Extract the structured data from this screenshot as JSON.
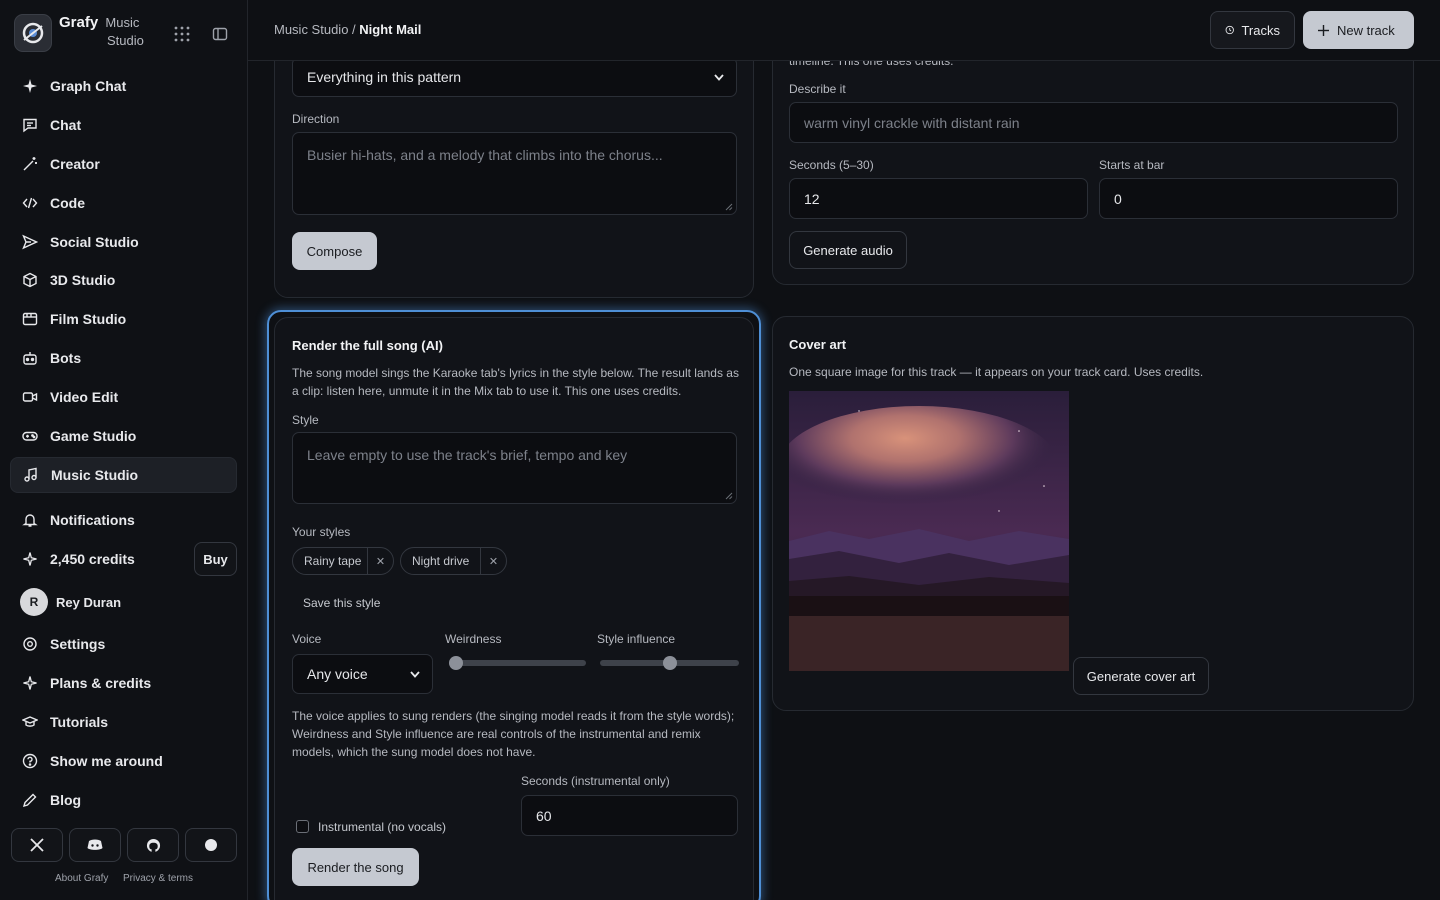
{
  "app": {
    "name": "Grafy",
    "sub_line1": "Music",
    "sub_line2": "Studio"
  },
  "sidebar": {
    "items": [
      {
        "label": "Graph Chat",
        "icon": "sparkle-icon"
      },
      {
        "label": "Chat",
        "icon": "chat-icon"
      },
      {
        "label": "Creator",
        "icon": "wand-icon"
      },
      {
        "label": "Code",
        "icon": "code-icon"
      },
      {
        "label": "Social Studio",
        "icon": "send-icon"
      },
      {
        "label": "3D Studio",
        "icon": "cube-icon"
      },
      {
        "label": "Film Studio",
        "icon": "film-icon"
      },
      {
        "label": "Bots",
        "icon": "bot-icon"
      },
      {
        "label": "Video Edit",
        "icon": "video-icon"
      },
      {
        "label": "Game Studio",
        "icon": "gamepad-icon"
      },
      {
        "label": "Music Studio",
        "icon": "music-icon"
      }
    ],
    "notifications": "Notifications",
    "credits": "2,450 credits",
    "buy": "Buy",
    "user": {
      "initial": "R",
      "name": "Rey Duran"
    },
    "settings": "Settings",
    "plans": "Plans & credits",
    "tutorials": "Tutorials",
    "tour": "Show me around",
    "blog": "Blog",
    "footer": {
      "about": "About Grafy",
      "privacy": "Privacy & terms"
    }
  },
  "topbar": {
    "crumb_parent": "Music Studio",
    "crumb_sep": " / ",
    "crumb_current": "Night Mail",
    "tracks": "Tracks",
    "new_track": "New track"
  },
  "compose": {
    "select_value": "Everything in this pattern",
    "direction_label": "Direction",
    "direction_placeholder": "Busier hi-hats, and a melody that climbs into the chorus...",
    "button": "Compose"
  },
  "sfx": {
    "cut_text": "timeline. This one uses credits.",
    "describe_label": "Describe it",
    "describe_placeholder": "warm vinyl crackle with distant rain",
    "seconds_label": "Seconds (5–30)",
    "seconds_value": "12",
    "bar_label": "Starts at bar",
    "bar_value": "0",
    "button": "Generate audio"
  },
  "render": {
    "title": "Render the full song (AI)",
    "desc_line1": "The song model sings the Karaoke tab's lyrics in the style below. The result lands as",
    "desc_line2": "a clip: listen here, unmute it in the Mix tab to use it. This one uses credits.",
    "style_label": "Style",
    "style_placeholder": "Leave empty to use the track's brief, tempo and key",
    "your_styles_label": "Your styles",
    "styles": [
      "Rainy tape",
      "Night drive"
    ],
    "save_style": "Save this style",
    "voice_label": "Voice",
    "voice_value": "Any voice",
    "weirdness_label": "Weirdness",
    "weirdness_value": 0,
    "influence_label": "Style influence",
    "influence_value": 0.5,
    "note_line1": "The voice applies to sung renders (the singing model reads it from the style words);",
    "note_line2": "Weirdness and Style influence are real controls of the instrumental and remix",
    "note_line3": "models, which the sung model does not have.",
    "seconds_label": "Seconds (instrumental only)",
    "seconds_value": "60",
    "instrumental_label": "Instrumental (no vocals)",
    "instrumental_checked": false,
    "button": "Render the song"
  },
  "cover": {
    "title": "Cover art",
    "desc": "One square image for this track — it appears on your track card. Uses credits.",
    "button": "Generate cover art"
  },
  "colors": {
    "accent": "#4e8fd6",
    "button_light": "#c5c9d1"
  }
}
